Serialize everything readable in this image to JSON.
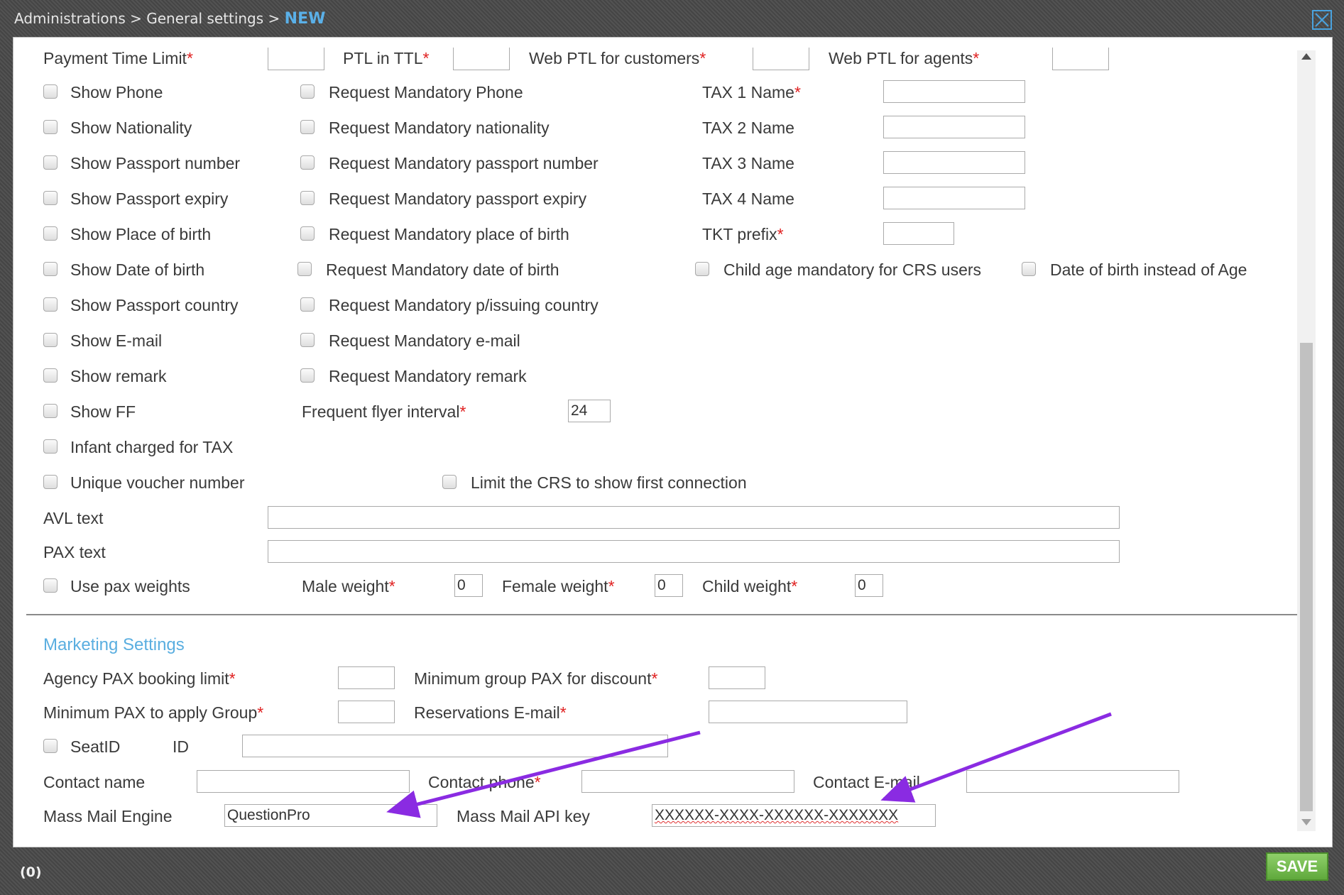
{
  "breadcrumb": {
    "path": "Administrations > General settings > ",
    "current": "NEW"
  },
  "ptl": {
    "payment_time_limit": "Payment Time Limit",
    "ptl_in_ttl": "PTL in TTL",
    "web_ptl_customers": "Web PTL for customers",
    "web_ptl_agents": "Web PTL for agents"
  },
  "show_options": [
    "Show Phone",
    "Show Nationality",
    "Show Passport number",
    "Show Passport expiry",
    "Show Place of birth",
    "Show Date of birth",
    "Show Passport country",
    "Show E-mail",
    "Show remark",
    "Show FF",
    "Infant charged for TAX",
    "Unique voucher number"
  ],
  "mandatory_options": [
    "Request Mandatory Phone",
    "Request Mandatory nationality",
    "Request Mandatory passport number",
    "Request Mandatory passport expiry",
    "Request Mandatory place of birth",
    "Request Mandatory date of birth",
    "Request Mandatory p/issuing country",
    "Request Mandatory e-mail",
    "Request Mandatory remark"
  ],
  "tax": {
    "tax1": "TAX 1 Name",
    "tax2": "TAX 2 Name",
    "tax3": "TAX 3 Name",
    "tax4": "TAX 4 Name",
    "tkt_prefix": "TKT prefix"
  },
  "child_age_mandatory": "Child age mandatory for CRS users",
  "dob_instead_age": "Date of birth instead of Age",
  "frequent_flyer": {
    "label": "Frequent flyer interval",
    "value": "24"
  },
  "limit_crs": "Limit the CRS to show first connection",
  "avl_text": "AVL text",
  "pax_text": "PAX text",
  "weights": {
    "use_pax_weights": "Use pax weights",
    "male": "Male weight",
    "male_value": "0",
    "female": "Female weight",
    "female_value": "0",
    "child": "Child weight",
    "child_value": "0"
  },
  "marketing": {
    "title": "Marketing Settings",
    "agency_pax_limit": "Agency PAX booking limit",
    "min_group_pax": "Minimum group PAX for discount",
    "min_pax_group": "Minimum PAX to apply Group",
    "reservations_email": "Reservations E-mail",
    "seat_id": "SeatID",
    "id": "ID",
    "contact_name": "Contact name",
    "contact_phone": "Contact phone",
    "contact_email": "Contact E-mail",
    "mass_mail_engine": "Mass Mail Engine",
    "mass_mail_engine_value": "QuestionPro",
    "mass_mail_api_key": "Mass Mail API key",
    "mass_mail_api_key_value": "XXXXXX-XXXX-XXXXXX-XXXXXXX"
  },
  "status": "(0)",
  "save_label": "SAVE",
  "required_mark": "*",
  "colors": {
    "accent": "#5aaee0",
    "required": "#e02020",
    "save": "#6ab545",
    "annotation_arrow": "#8a2be2"
  }
}
